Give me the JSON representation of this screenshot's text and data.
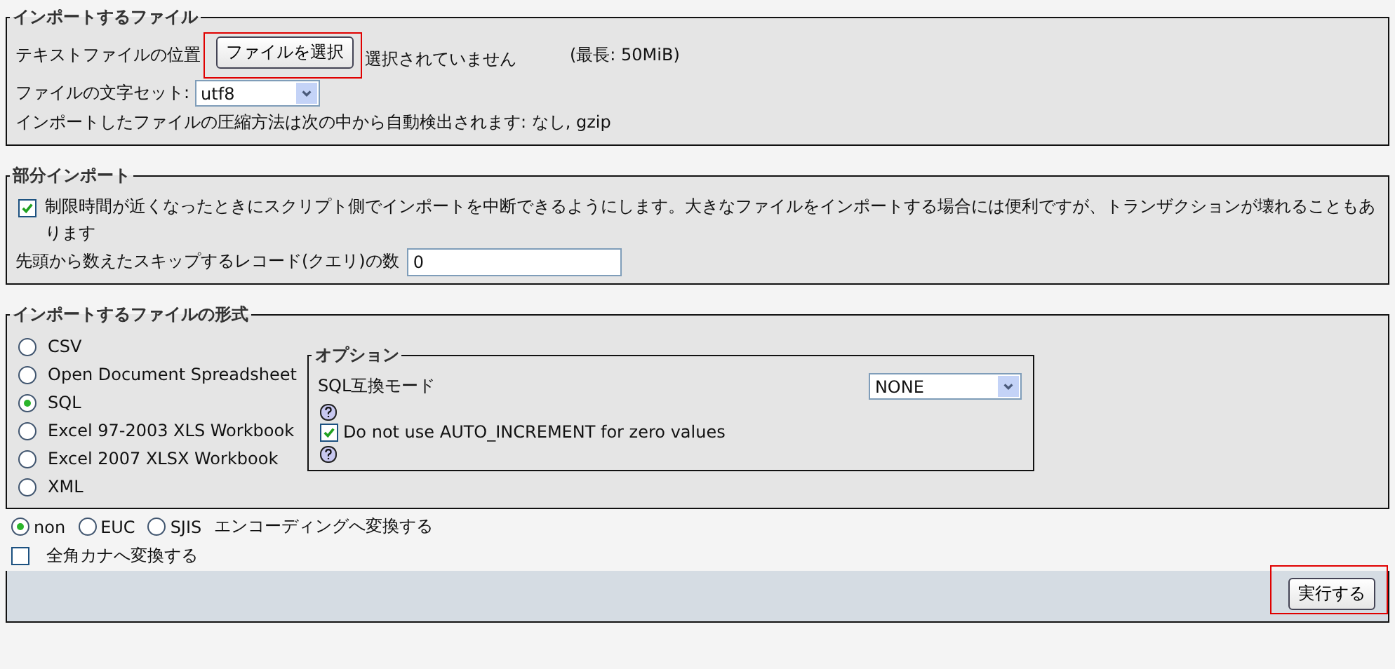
{
  "file_section": {
    "legend": "インポートするファイル",
    "location_label": "テキストファイルの位置",
    "choose_button": {
      "label": "ファイルを選択",
      "highlighted": true
    },
    "no_file_text": "選択されていません",
    "max_size": "(最長: 50MiB)",
    "charset_label": "ファイルの文字セット:",
    "charset_value": "utf8",
    "compression_note": "インポートしたファイルの圧縮方法は次の中から自動検出されます: なし, gzip"
  },
  "partial_section": {
    "legend": "部分インポート",
    "interrupt": {
      "label": "制限時間が近くなったときにスクリプト側でインポートを中断できるようにします。大きなファイルをインポートする場合には便利ですが、トランザクションが壊れることもあります",
      "checked": true
    },
    "skip_label": "先頭から数えたスキップするレコード(クエリ)の数",
    "skip_value": "0"
  },
  "format_section": {
    "legend": "インポートするファイルの形式",
    "formats": [
      {
        "label": "CSV",
        "selected": false
      },
      {
        "label": "Open Document Spreadsheet",
        "selected": false
      },
      {
        "label": "SQL",
        "selected": true
      },
      {
        "label": "Excel 97-2003 XLS Workbook",
        "selected": false
      },
      {
        "label": "Excel 2007 XLSX Workbook",
        "selected": false
      },
      {
        "label": "XML",
        "selected": false
      }
    ],
    "options": {
      "legend": "オプション",
      "compat_label": "SQL互換モード",
      "compat_value": "NONE",
      "no_auto_increment": {
        "label": "Do not use AUTO_INCREMENT for zero values",
        "checked": true
      }
    }
  },
  "encodings": [
    {
      "label": "non",
      "selected": true
    },
    {
      "label": "EUC",
      "selected": false
    },
    {
      "label": "SJIS",
      "selected": false
    }
  ],
  "encoding_suffix": "エンコーディングへ変換する",
  "kana": {
    "label": "全角カナへ変換する",
    "checked": false
  },
  "submit": {
    "label": "実行する",
    "highlighted": true
  }
}
